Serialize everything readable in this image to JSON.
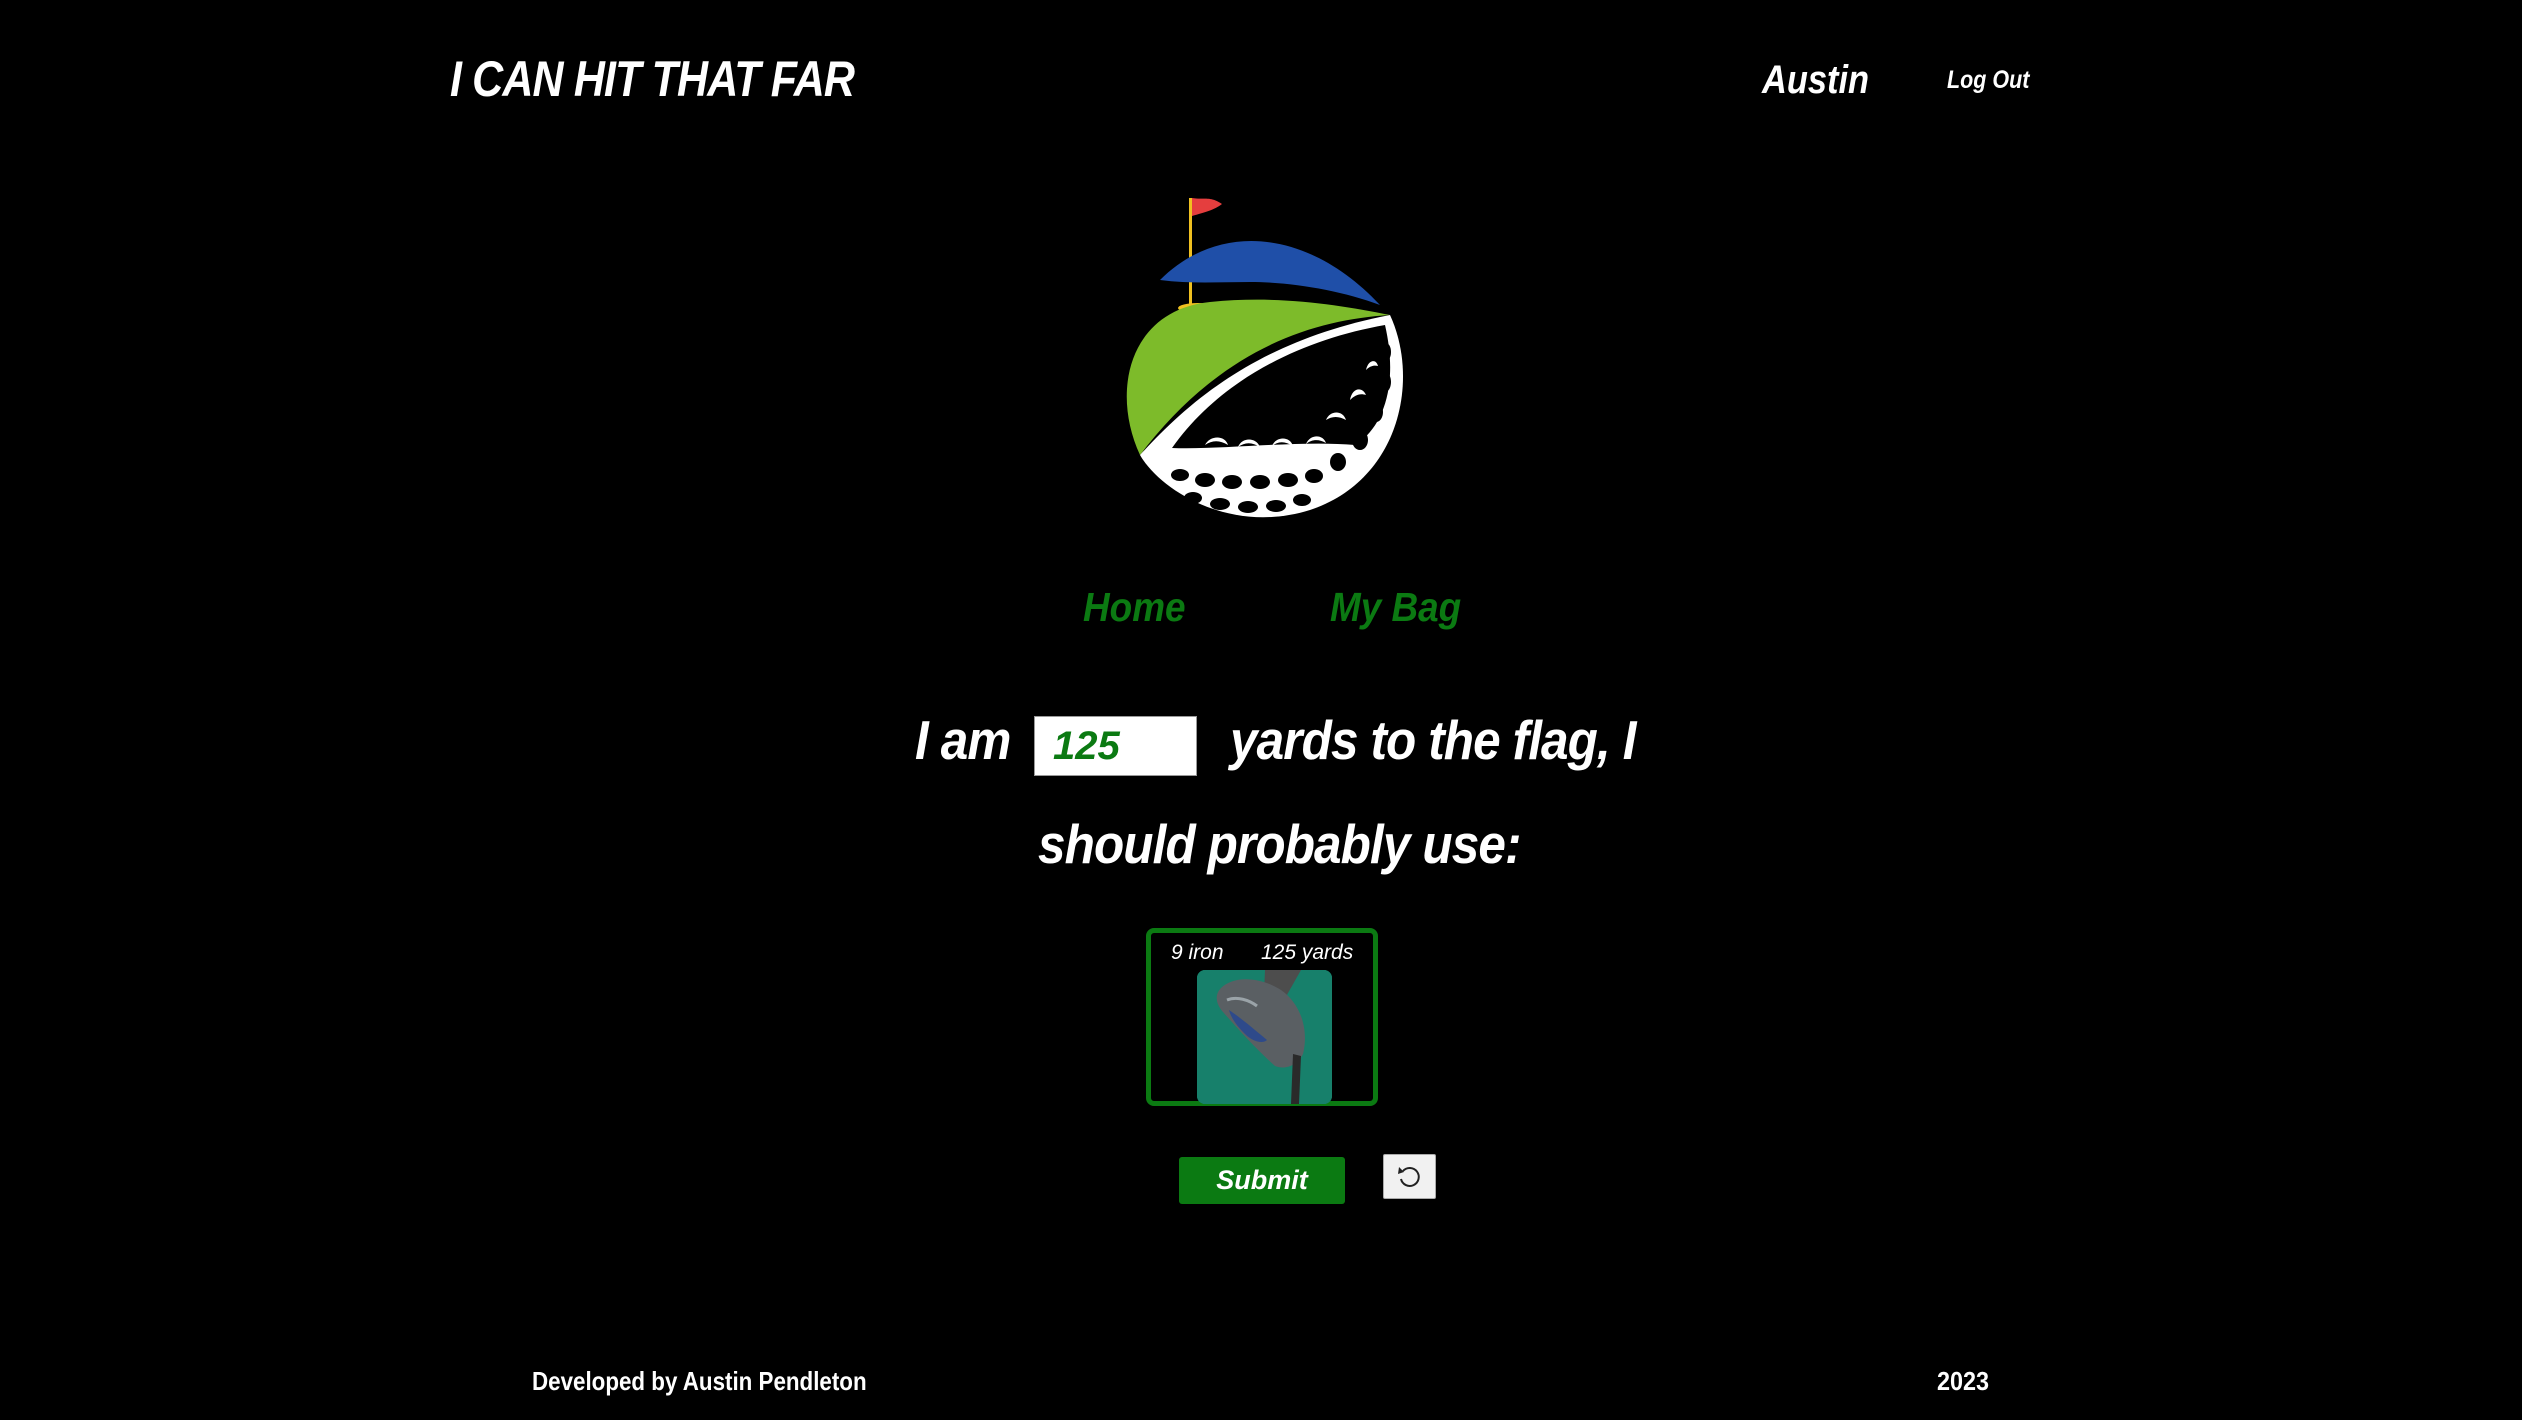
{
  "header": {
    "app_title": "I CAN HIT THAT FAR",
    "user_name": "Austin",
    "logout_label": "Log Out"
  },
  "nav": {
    "home_label": "Home",
    "bag_label": "My Bag"
  },
  "prompt": {
    "lead": "I am",
    "mid": "yards to the flag, I",
    "end": "should probably use:",
    "yards_value": "125"
  },
  "recommendation": {
    "club_name": "9 iron",
    "club_distance": "125 yards",
    "image_icon": "golf-iron-club"
  },
  "actions": {
    "submit_label": "Submit",
    "reset_icon": "refresh-icon"
  },
  "footer": {
    "credit": "Developed by Austin Pendleton",
    "year": "2023"
  },
  "colors": {
    "background": "#000000",
    "accent_green": "#0b7a12",
    "text": "#ffffff"
  }
}
